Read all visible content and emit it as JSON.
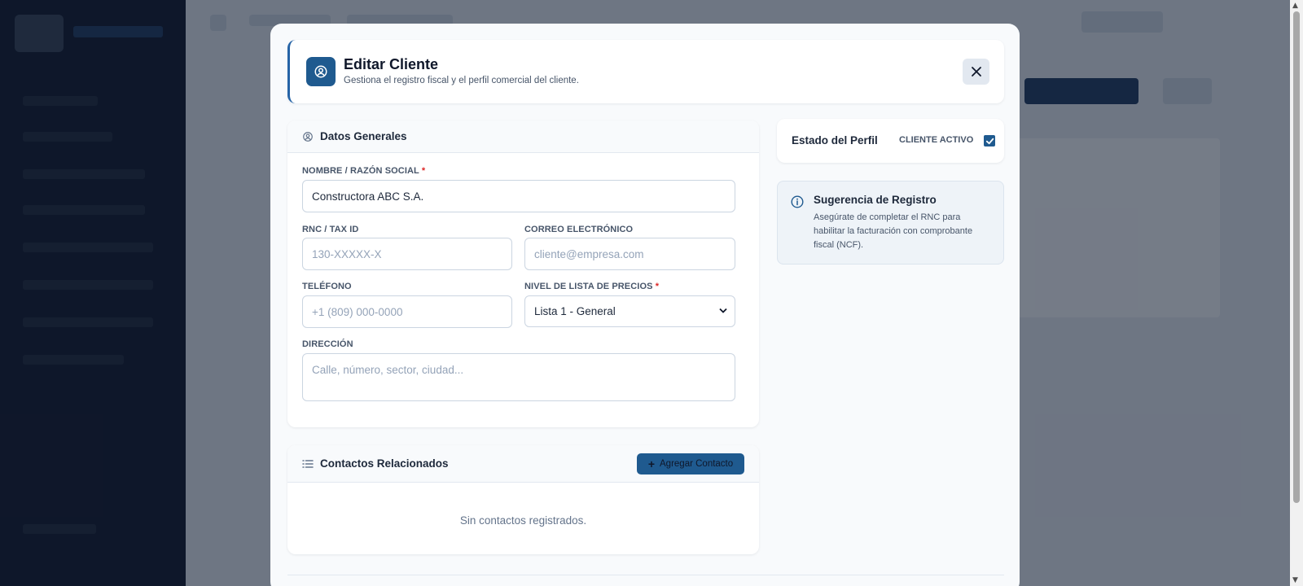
{
  "modal": {
    "title": "Editar Cliente",
    "subtitle": "Gestiona el registro fiscal y el perfil comercial del cliente.",
    "close_icon": "close-icon"
  },
  "datos_generales": {
    "title": "Datos Generales",
    "nombre": {
      "label": "NOMBRE / RAZÓN SOCIAL",
      "required_mark": "*",
      "value": "Constructora ABC S.A."
    },
    "rnc": {
      "label": "RNC / TAX ID",
      "placeholder": "130-XXXXX-X"
    },
    "correo": {
      "label": "CORREO ELECTRÓNICO",
      "placeholder": "cliente@empresa.com"
    },
    "telefono": {
      "label": "TELÉFONO",
      "placeholder": "+1 (809) 000-0000"
    },
    "nivel_precios": {
      "label": "NIVEL DE LISTA DE PRECIOS",
      "required_mark": "*",
      "selected": "Lista 1 - General"
    },
    "direccion": {
      "label": "DIRECCIÓN",
      "placeholder": "Calle, número, sector, ciudad..."
    }
  },
  "contactos": {
    "title": "Contactos Relacionados",
    "add_button": "Agregar Contacto",
    "empty_message": "Sin contactos registrados."
  },
  "estado_perfil": {
    "title": "Estado del Perfil",
    "active_label": "CLIENTE ACTIVO",
    "active": true
  },
  "sugerencia": {
    "title": "Sugerencia de Registro",
    "text": "Asegúrate de completar el RNC para habilitar la facturación con comprobante fiscal (NCF)."
  },
  "colors": {
    "primary": "#1f5a8f",
    "required": "#dc2626",
    "overlay": "rgba(15, 23, 42, 0.55)"
  }
}
